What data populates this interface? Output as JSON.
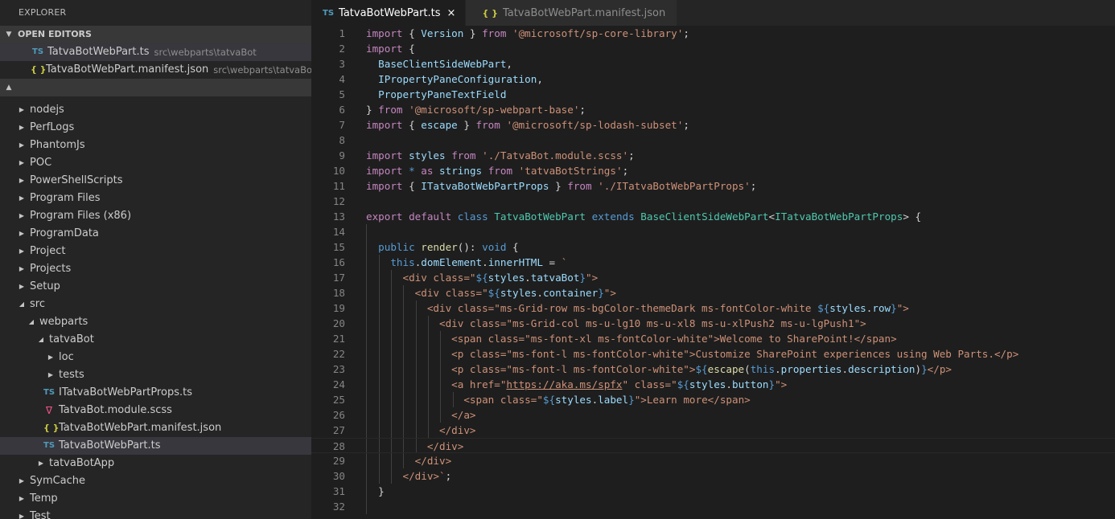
{
  "sidebar": {
    "title": "EXPLORER",
    "open_editors": {
      "label": "OPEN EDITORS",
      "items": [
        {
          "icon": "TS",
          "name": "TatvaBotWebPart.ts",
          "path": "src\\webparts\\tatvaBot"
        },
        {
          "icon": "{ }",
          "name": "TatvaBotWebPart.manifest.json",
          "path": "src\\webparts\\tatvaBot"
        }
      ]
    },
    "tree": [
      {
        "label": "nodejs"
      },
      {
        "label": "PerfLogs"
      },
      {
        "label": "PhantomJs"
      },
      {
        "label": "POC"
      },
      {
        "label": "PowerShellScripts"
      },
      {
        "label": "Program Files"
      },
      {
        "label": "Program Files (x86)"
      },
      {
        "label": "ProgramData"
      },
      {
        "label": "Project"
      },
      {
        "label": "Projects"
      },
      {
        "label": "Setup"
      },
      {
        "label": "src"
      },
      {
        "label": "webparts"
      },
      {
        "label": "tatvaBot"
      },
      {
        "label": "loc"
      },
      {
        "label": "tests"
      },
      {
        "label": "ITatvaBotWebPartProps.ts",
        "icon": "TS"
      },
      {
        "label": "TatvaBot.module.scss"
      },
      {
        "label": "TatvaBotWebPart.manifest.json",
        "icon": "{ }"
      },
      {
        "label": "TatvaBotWebPart.ts",
        "icon": "TS"
      },
      {
        "label": "tatvaBotApp"
      },
      {
        "label": "SymCache"
      },
      {
        "label": "Temp"
      },
      {
        "label": "Test"
      }
    ]
  },
  "tabs": [
    {
      "icon": "TS",
      "label": "TatvaBotWebPart.ts",
      "close": "×"
    },
    {
      "icon": "{ }",
      "label": "TatvaBotWebPart.manifest.json"
    }
  ],
  "line_numbers": [
    "1",
    "2",
    "3",
    "4",
    "5",
    "6",
    "7",
    "8",
    "9",
    "10",
    "11",
    "12",
    "13",
    "14",
    "15",
    "16",
    "17",
    "18",
    "19",
    "20",
    "21",
    "22",
    "23",
    "24",
    "25",
    "26",
    "27",
    "28",
    "29",
    "30",
    "31",
    "32"
  ],
  "colors": {
    "keyword": "#c586c0",
    "storage": "#569cd6",
    "string": "#ce9178",
    "variable": "#9cdcfe",
    "type": "#4ec9b0",
    "function": "#dcdcaa",
    "ts_icon": "#519aba",
    "json_icon": "#cbcb41",
    "scss_icon": "#f55385"
  }
}
